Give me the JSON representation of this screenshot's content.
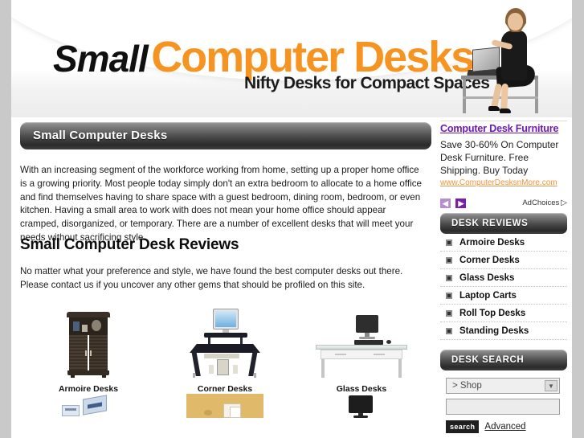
{
  "site": {
    "logo_word_1": "Small",
    "logo_word_2": "Computer Desks",
    "tagline": "Nifty Desks for Compact Spaces"
  },
  "main": {
    "page_title": "Small Computer Desks",
    "intro_paragraph": "With an increasing segment of the workforce working from home, setting up a proper home office is a growing priority.  Most people today simply don't an extra bedroom to allocate to a home office and find themselves having to share space with a guest bedroom, dining room, bedroom, or even kitchen.  Having a small area to work with does not mean your home office should appear cramped, disorganized, or temporary.  There are a number of excellent desks that will meet your needs without sacrificing style.",
    "reviews_heading": "Small Computer Desk Reviews",
    "reviews_paragraph": "No matter what your preference and style, we have found the best computer desks out there.  Please contact us if you uncover any other gems that should be profiled on this site.",
    "products_row1": [
      {
        "label": "Armoire Desks",
        "icon": "armoire-desk-thumbnail"
      },
      {
        "label": "Corner Desks",
        "icon": "corner-desk-thumbnail"
      },
      {
        "label": "Glass Desks",
        "icon": "glass-desk-thumbnail"
      }
    ],
    "products_row2": [
      {
        "label": "",
        "icon": "laptop-cart-thumbnail"
      },
      {
        "label": "",
        "icon": "roll-top-desk-thumbnail"
      },
      {
        "label": "",
        "icon": "standing-desk-thumbnail"
      }
    ]
  },
  "sidebar": {
    "ad": {
      "title": "Computer Desk Furniture",
      "body": "Save 30-60% On Computer Desk Furniture. Free Shipping. Buy Today",
      "url": "www.ComputerDesksnMore.com",
      "prev_arrow": "◀",
      "next_arrow": "▶",
      "adchoices_label": "AdChoices",
      "adchoices_glyph": "▷",
      "title_color": "#6f1ab1",
      "url_color": "#f1943c"
    },
    "reviews": {
      "heading": "DESK REVIEWS",
      "items": [
        {
          "label": "Armoire Desks"
        },
        {
          "label": "Corner Desks"
        },
        {
          "label": "Glass Desks"
        },
        {
          "label": "Laptop Carts"
        },
        {
          "label": "Roll Top Desks"
        },
        {
          "label": "Standing Desks"
        }
      ]
    },
    "search": {
      "heading": "DESK SEARCH",
      "scope_value": "> Shop",
      "caret_glyph": "▼",
      "query_value": "",
      "query_placeholder": "",
      "button_label": "search",
      "advanced_label": "Advanced"
    }
  },
  "theme": {
    "accent_orange": "#f79421",
    "page_background": "#c9c9c9",
    "bar_dark": "#2a2a2a"
  }
}
